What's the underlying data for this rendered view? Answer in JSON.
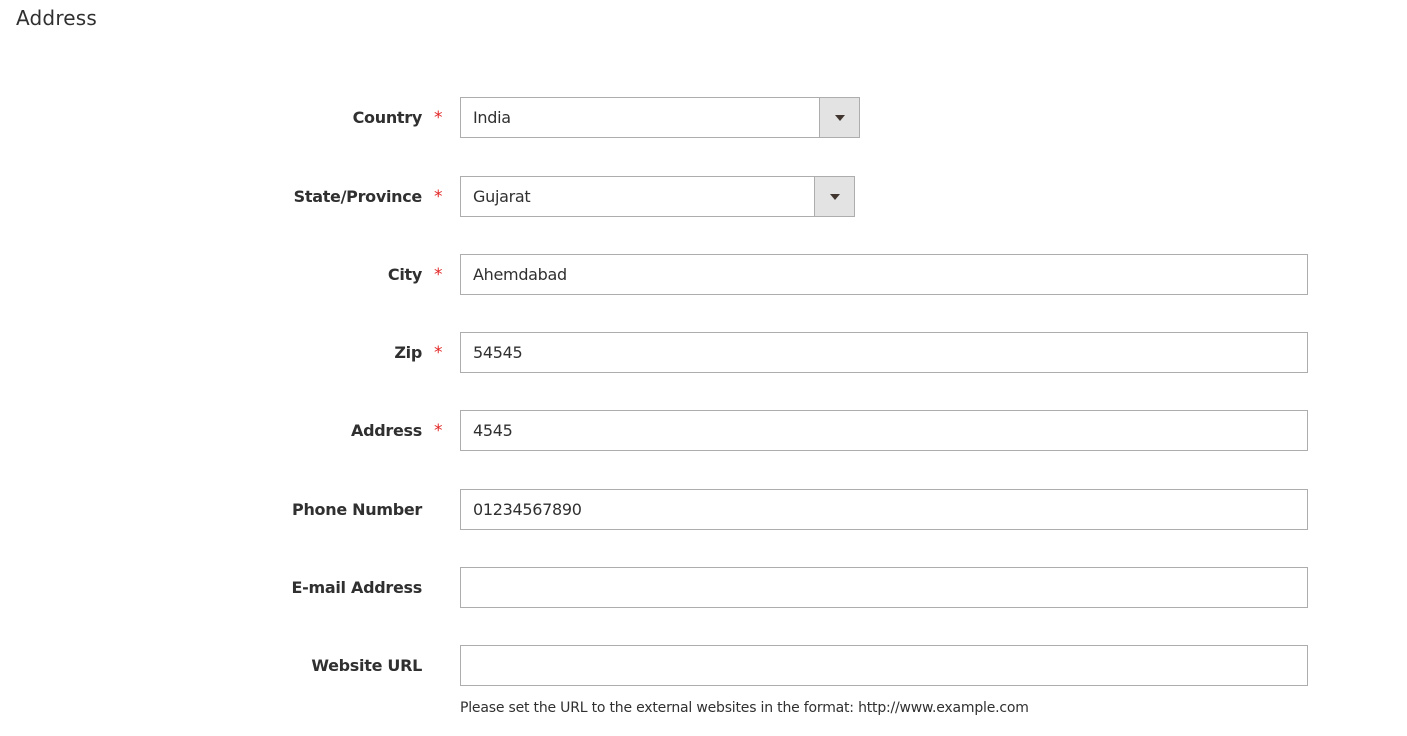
{
  "section": {
    "title": "Address"
  },
  "fields": {
    "country": {
      "label": "Country",
      "required": "*",
      "value": "India"
    },
    "state": {
      "label": "State/Province",
      "required": "*",
      "value": "Gujarat"
    },
    "city": {
      "label": "City",
      "required": "*",
      "value": "Ahemdabad"
    },
    "zip": {
      "label": "Zip",
      "required": "*",
      "value": "54545"
    },
    "address": {
      "label": "Address",
      "required": "*",
      "value": "4545"
    },
    "phone": {
      "label": "Phone Number",
      "value": "01234567890"
    },
    "email": {
      "label": "E-mail Address",
      "value": ""
    },
    "website": {
      "label": "Website URL",
      "value": "",
      "note": "Please set the URL to the external websites in the format: http://www.example.com"
    }
  },
  "colors": {
    "required_star": "#e22626",
    "input_border": "#adadad",
    "select_arrow_bg": "#e3e3e3",
    "text": "#303030"
  },
  "icons": {
    "select_arrow": "triangle-down-icon"
  }
}
